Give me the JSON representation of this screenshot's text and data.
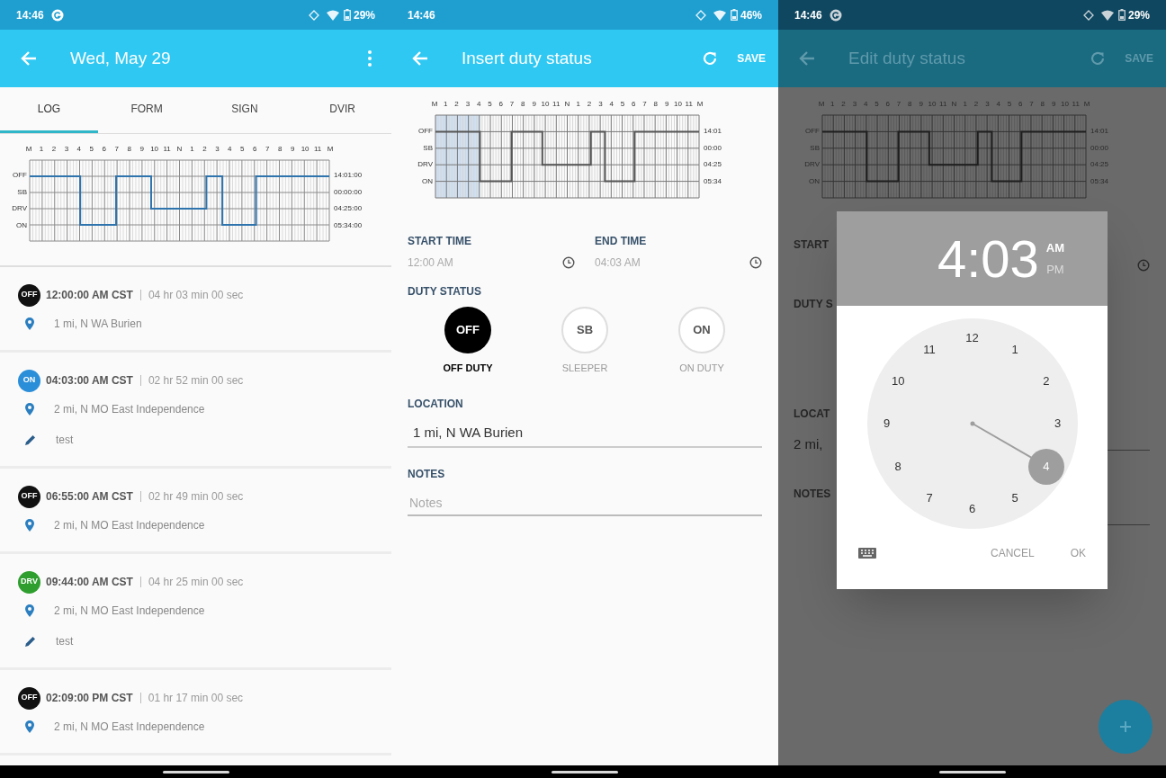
{
  "panels": [
    {
      "kind": "log",
      "status_bar": {
        "time": "14:46",
        "notification_icon": true,
        "battery": "29%"
      },
      "app_bar": {
        "title": "Wed, May 29",
        "menu": true
      },
      "tabs": [
        {
          "label": "LOG",
          "selected": true
        },
        {
          "label": "FORM",
          "selected": false
        },
        {
          "label": "SIGN",
          "selected": false
        },
        {
          "label": "DVIR",
          "selected": false
        }
      ],
      "graph": {
        "hour_labels": [
          "M",
          "1",
          "2",
          "3",
          "4",
          "5",
          "6",
          "7",
          "8",
          "9",
          "10",
          "11",
          "N",
          "1",
          "2",
          "3",
          "4",
          "5",
          "6",
          "7",
          "8",
          "9",
          "10",
          "11",
          "M"
        ],
        "status_labels": [
          "OFF",
          "SB",
          "DRV",
          "ON"
        ],
        "totals": [
          "14:01:00",
          "00:00:00",
          "04:25:00",
          "05:34:00"
        ]
      },
      "events": [
        {
          "status": "OFF",
          "color": "#111111",
          "time": "12:00:00 AM CST",
          "duration": "04 hr 03 min 00 sec",
          "location": "1 mi, N WA Burien"
        },
        {
          "status": "ON",
          "color": "#2b8ed8",
          "time": "04:03:00 AM CST",
          "duration": "02 hr 52 min 00 sec",
          "location": "2 mi, N MO East Independence",
          "note": "test"
        },
        {
          "status": "OFF",
          "color": "#111111",
          "time": "06:55:00 AM CST",
          "duration": "02 hr 49 min 00 sec",
          "location": "2 mi, N MO East Independence"
        },
        {
          "status": "DRV",
          "color": "#2e9e2e",
          "time": "09:44:00 AM CST",
          "duration": "04 hr 25 min 00 sec",
          "location": "2 mi, N MO East Independence",
          "note": "test"
        },
        {
          "status": "OFF",
          "color": "#111111",
          "time": "02:09:00 PM CST",
          "duration": "01 hr 17 min 00 sec",
          "location": "2 mi, N MO East Independence"
        }
      ]
    },
    {
      "kind": "insert",
      "status_bar": {
        "time": "14:46",
        "notification_icon": false,
        "battery": "46%"
      },
      "app_bar": {
        "title": "Insert duty status",
        "action": "SAVE"
      },
      "graph": {
        "hour_labels": [
          "M",
          "1",
          "2",
          "3",
          "4",
          "5",
          "6",
          "7",
          "8",
          "9",
          "10",
          "11",
          "N",
          "1",
          "2",
          "3",
          "4",
          "5",
          "6",
          "7",
          "8",
          "9",
          "10",
          "11",
          "M"
        ],
        "status_labels": [
          "OFF",
          "SB",
          "DRV",
          "ON"
        ],
        "totals": [
          "14:01",
          "00:00",
          "04:25",
          "05:34"
        ]
      },
      "start_time": {
        "label": "START TIME",
        "value": "12:00 AM"
      },
      "end_time": {
        "label": "END TIME",
        "value": "04:03 AM"
      },
      "duty_status": {
        "label": "DUTY STATUS",
        "options": [
          {
            "badge": "OFF",
            "label": "OFF DUTY",
            "selected": true
          },
          {
            "badge": "SB",
            "label": "SLEEPER",
            "selected": false
          },
          {
            "badge": "ON",
            "label": "ON DUTY",
            "selected": false
          }
        ]
      },
      "location": {
        "label": "LOCATION",
        "value": "1 mi, N WA Burien"
      },
      "notes": {
        "label": "NOTES",
        "placeholder": "Notes"
      }
    },
    {
      "kind": "edit",
      "status_bar": {
        "time": "14:46",
        "notification_icon": true,
        "battery": "29%"
      },
      "app_bar": {
        "title": "Edit duty status",
        "action": "SAVE"
      },
      "graph": {
        "hour_labels": [
          "M",
          "1",
          "2",
          "3",
          "4",
          "5",
          "6",
          "7",
          "8",
          "9",
          "10",
          "11",
          "N",
          "1",
          "2",
          "3",
          "4",
          "5",
          "6",
          "7",
          "8",
          "9",
          "10",
          "11",
          "M"
        ],
        "status_labels": [
          "OFF",
          "SB",
          "DRV",
          "ON"
        ],
        "totals": [
          "14:01",
          "00:00",
          "04:25",
          "05:34"
        ]
      },
      "covered_texts": [
        "START",
        "DUTY S",
        "LOCAT",
        "2 mi,",
        "NOTES"
      ],
      "time_picker": {
        "time": "4:03",
        "periods": [
          {
            "label": "AM",
            "selected": true
          },
          {
            "label": "PM",
            "selected": false
          }
        ],
        "dial": [
          {
            "label": "12",
            "selected": false
          },
          {
            "label": "1",
            "selected": false
          },
          {
            "label": "2",
            "selected": false
          },
          {
            "label": "3",
            "selected": false
          },
          {
            "label": "4",
            "selected": true
          },
          {
            "label": "5",
            "selected": false
          },
          {
            "label": "6",
            "selected": false
          },
          {
            "label": "7",
            "selected": false
          },
          {
            "label": "8",
            "selected": false
          },
          {
            "label": "9",
            "selected": false
          },
          {
            "label": "10",
            "selected": false
          },
          {
            "label": "11",
            "selected": false
          }
        ],
        "buttons": [
          "CANCEL",
          "OK"
        ]
      }
    }
  ]
}
